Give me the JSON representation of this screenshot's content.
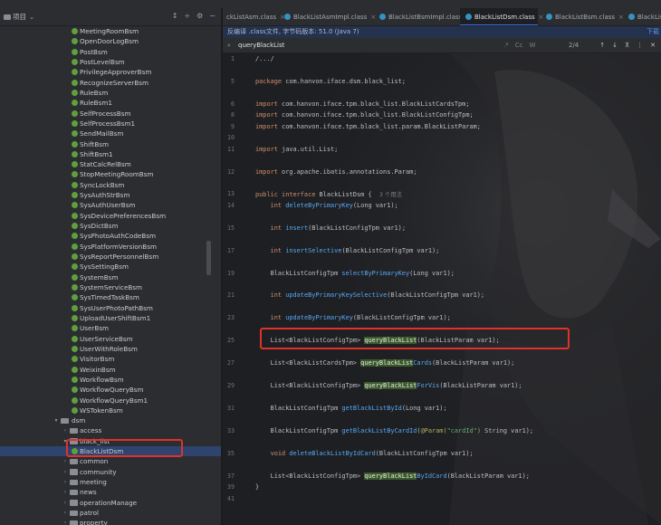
{
  "project_panel": {
    "title": "项目"
  },
  "tree": [
    {
      "label": "MeetingRoomBsm",
      "type": "class",
      "depth": 3
    },
    {
      "label": "OpenDoorLogBsm",
      "type": "class",
      "depth": 3
    },
    {
      "label": "PostBsm",
      "type": "class",
      "depth": 3
    },
    {
      "label": "PostLevelBsm",
      "type": "class",
      "depth": 3
    },
    {
      "label": "PrivilegeApproverBsm",
      "type": "class",
      "depth": 3
    },
    {
      "label": "RecognizeServerBsm",
      "type": "class",
      "depth": 3
    },
    {
      "label": "RuleBsm",
      "type": "class",
      "depth": 3
    },
    {
      "label": "RuleBsm1",
      "type": "class",
      "depth": 3
    },
    {
      "label": "SelfProcessBsm",
      "type": "class",
      "depth": 3
    },
    {
      "label": "SelfProcessBsm1",
      "type": "class",
      "depth": 3
    },
    {
      "label": "SendMailBsm",
      "type": "class",
      "depth": 3
    },
    {
      "label": "ShiftBsm",
      "type": "class",
      "depth": 3
    },
    {
      "label": "ShiftBsm1",
      "type": "class",
      "depth": 3
    },
    {
      "label": "StatCalcRelBsm",
      "type": "class",
      "depth": 3
    },
    {
      "label": "StopMeetingRoomBsm",
      "type": "class",
      "depth": 3
    },
    {
      "label": "SyncLockBsm",
      "type": "class",
      "depth": 3
    },
    {
      "label": "SysAuthStrBsm",
      "type": "class",
      "depth": 3
    },
    {
      "label": "SysAuthUserBsm",
      "type": "class",
      "depth": 3
    },
    {
      "label": "SysDevicePreferencesBsm",
      "type": "class",
      "depth": 3
    },
    {
      "label": "SysDictBsm",
      "type": "class",
      "depth": 3
    },
    {
      "label": "SysPhotoAuthCodeBsm",
      "type": "class",
      "depth": 3
    },
    {
      "label": "SysPlatformVersionBsm",
      "type": "class",
      "depth": 3
    },
    {
      "label": "SysReportPersonnelBsm",
      "type": "class",
      "depth": 3
    },
    {
      "label": "SysSettingBsm",
      "type": "class",
      "depth": 3
    },
    {
      "label": "SystemBsm",
      "type": "class",
      "depth": 3
    },
    {
      "label": "SystemServiceBsm",
      "type": "class",
      "depth": 3
    },
    {
      "label": "SysTimedTaskBsm",
      "type": "class",
      "depth": 3
    },
    {
      "label": "SysUserPhotoPathBsm",
      "type": "class",
      "depth": 3
    },
    {
      "label": "UploadUserShiftBsm1",
      "type": "class",
      "depth": 3
    },
    {
      "label": "UserBsm",
      "type": "class",
      "depth": 3
    },
    {
      "label": "UserServiceBsm",
      "type": "class",
      "depth": 3
    },
    {
      "label": "UserWithRoleBsm",
      "type": "class",
      "depth": 3
    },
    {
      "label": "VisitorBsm",
      "type": "class",
      "depth": 3
    },
    {
      "label": "WeixinBsm",
      "type": "class",
      "depth": 3
    },
    {
      "label": "WorkflowBsm",
      "type": "class",
      "depth": 3
    },
    {
      "label": "WorkflowQueryBsm",
      "type": "class",
      "depth": 3
    },
    {
      "label": "WorkflowQueryBsm1",
      "type": "class",
      "depth": 3
    },
    {
      "label": "WSTokenBsm",
      "type": "class",
      "depth": 3
    },
    {
      "label": "dsm",
      "type": "folder",
      "depth": 1,
      "expanded": true
    },
    {
      "label": "access",
      "type": "folder",
      "depth": 2,
      "expanded": false
    },
    {
      "label": "black_list",
      "type": "folder",
      "depth": 2,
      "expanded": true
    },
    {
      "label": "BlackListDsm",
      "type": "class",
      "depth": 3,
      "selected": true
    },
    {
      "label": "common",
      "type": "folder",
      "depth": 2,
      "expanded": false
    },
    {
      "label": "community",
      "type": "folder",
      "depth": 2,
      "expanded": false
    },
    {
      "label": "meeting",
      "type": "folder",
      "depth": 2,
      "expanded": false
    },
    {
      "label": "news",
      "type": "folder",
      "depth": 2,
      "expanded": false
    },
    {
      "label": "operationManage",
      "type": "folder",
      "depth": 2,
      "expanded": false
    },
    {
      "label": "patrol",
      "type": "folder",
      "depth": 2,
      "expanded": false
    },
    {
      "label": "property",
      "type": "folder",
      "depth": 2,
      "expanded": false
    }
  ],
  "tabs": [
    {
      "label": "ckListAsm.class",
      "active": false
    },
    {
      "label": "BlackListAsmImpl.class",
      "active": false
    },
    {
      "label": "BlackListBsmImpl.class",
      "active": false
    },
    {
      "label": "BlackListDsm.class",
      "active": true
    },
    {
      "label": "BlackListBsm.class",
      "active": false
    },
    {
      "label": "BlackListDs",
      "active": false
    }
  ],
  "notice": {
    "text": "反编译 .class文件, 字节码版本: 51.0 (Java 7)",
    "link": "下载"
  },
  "find": {
    "query": "queryBlackList",
    "opt_case": "Cc",
    "opt_word": "W",
    "opt_regex": ".*",
    "count": "2/4"
  },
  "line_numbers": [
    "1",
    "5",
    "6",
    "8",
    "9",
    "10",
    "11",
    "12",
    "13",
    "14",
    "15",
    "17",
    "19",
    "21",
    "23",
    "25",
    "27",
    "29",
    "31",
    "33",
    "35",
    "37",
    "39",
    "41"
  ],
  "code": [
    [
      {
        "t": "/.../",
        "c": "plain"
      }
    ],
    [],
    [
      {
        "t": "package ",
        "c": "kw"
      },
      {
        "t": "com.hanvon.iface.dsm.black_list;",
        "c": "plain"
      }
    ],
    [],
    [
      {
        "t": "import ",
        "c": "kw"
      },
      {
        "t": "com.hanvon.iface.tpm.black_list.BlackListCardsTpm;",
        "c": "plain"
      }
    ],
    [
      {
        "t": "import ",
        "c": "kw"
      },
      {
        "t": "com.hanvon.iface.tpm.black_list.BlackListConfigTpm;",
        "c": "plain"
      }
    ],
    [
      {
        "t": "import ",
        "c": "kw"
      },
      {
        "t": "com.hanvon.iface.tpm.black_list.param.BlackListParam;",
        "c": "plain"
      }
    ],
    [],
    [
      {
        "t": "import ",
        "c": "kw"
      },
      {
        "t": "java.util.List;",
        "c": "plain"
      }
    ],
    [],
    [
      {
        "t": "import ",
        "c": "kw"
      },
      {
        "t": "org.apache.ibatis.annotations.Param;",
        "c": "plain"
      }
    ],
    [],
    [
      {
        "t": "public interface ",
        "c": "kw"
      },
      {
        "t": "BlackListDsm {  ",
        "c": "plain"
      },
      {
        "t": "3 个用法",
        "c": "hint"
      }
    ],
    [
      {
        "t": "    int ",
        "c": "kw"
      },
      {
        "t": "deleteByPrimaryKey",
        "c": "fn"
      },
      {
        "t": "(Long var1);",
        "c": "plain"
      }
    ],
    [],
    [
      {
        "t": "    int ",
        "c": "kw"
      },
      {
        "t": "insert",
        "c": "fn"
      },
      {
        "t": "(BlackListConfigTpm var1);",
        "c": "plain"
      }
    ],
    [],
    [
      {
        "t": "    int ",
        "c": "kw"
      },
      {
        "t": "insertSelective",
        "c": "fn"
      },
      {
        "t": "(BlackListConfigTpm var1);",
        "c": "plain"
      }
    ],
    [],
    [
      {
        "t": "    BlackListConfigTpm ",
        "c": "plain"
      },
      {
        "t": "selectByPrimaryKey",
        "c": "fn"
      },
      {
        "t": "(Long var1);",
        "c": "plain"
      }
    ],
    [],
    [
      {
        "t": "    int ",
        "c": "kw"
      },
      {
        "t": "updateByPrimaryKeySelective",
        "c": "fn"
      },
      {
        "t": "(BlackListConfigTpm var1);",
        "c": "plain"
      }
    ],
    [],
    [
      {
        "t": "    int ",
        "c": "kw"
      },
      {
        "t": "updateByPrimaryKey",
        "c": "fn"
      },
      {
        "t": "(BlackListConfigTpm var1);",
        "c": "plain"
      }
    ],
    [],
    [
      {
        "t": "    List<BlackListConfigTpm> ",
        "c": "plain"
      },
      {
        "t": "queryBlackList",
        "c": "hl"
      },
      {
        "t": "(BlackListParam var1);",
        "c": "plain"
      }
    ],
    [],
    [
      {
        "t": "    List<BlackListCardsTpm> ",
        "c": "plain"
      },
      {
        "t": "queryBlackList",
        "c": "hl"
      },
      {
        "t": "Cards",
        "c": "fn"
      },
      {
        "t": "(BlackListParam var1);",
        "c": "plain"
      }
    ],
    [],
    [
      {
        "t": "    List<BlackListConfigTpm> ",
        "c": "plain"
      },
      {
        "t": "queryBlackList",
        "c": "hl"
      },
      {
        "t": "ForVis",
        "c": "fn"
      },
      {
        "t": "(BlackListParam var1);",
        "c": "plain"
      }
    ],
    [],
    [
      {
        "t": "    BlackListConfigTpm ",
        "c": "plain"
      },
      {
        "t": "getBlackListById",
        "c": "fn"
      },
      {
        "t": "(Long var1);",
        "c": "plain"
      }
    ],
    [],
    [
      {
        "t": "    BlackListConfigTpm ",
        "c": "plain"
      },
      {
        "t": "getBlackListByCardId",
        "c": "fn"
      },
      {
        "t": "(",
        "c": "plain"
      },
      {
        "t": "@Param(",
        "c": "ann"
      },
      {
        "t": "\"cardId\"",
        "c": "str"
      },
      {
        "t": ") ",
        "c": "ann"
      },
      {
        "t": "String var1);",
        "c": "plain"
      }
    ],
    [],
    [
      {
        "t": "    void ",
        "c": "kw"
      },
      {
        "t": "deleteBlackListByIdCard",
        "c": "fn"
      },
      {
        "t": "(BlackListConfigTpm var1);",
        "c": "plain"
      }
    ],
    [],
    [
      {
        "t": "    List<BlackListConfigTpm> ",
        "c": "plain"
      },
      {
        "t": "queryBlackList",
        "c": "hl"
      },
      {
        "t": "ByIdCard",
        "c": "fn"
      },
      {
        "t": "(BlackListParam var1);",
        "c": "plain"
      }
    ],
    [
      {
        "t": "}",
        "c": "plain"
      }
    ],
    [],
    []
  ],
  "colors": {
    "highlight_box": "#e0312b",
    "selection": "#2e436e",
    "accent": "#3574f0"
  }
}
